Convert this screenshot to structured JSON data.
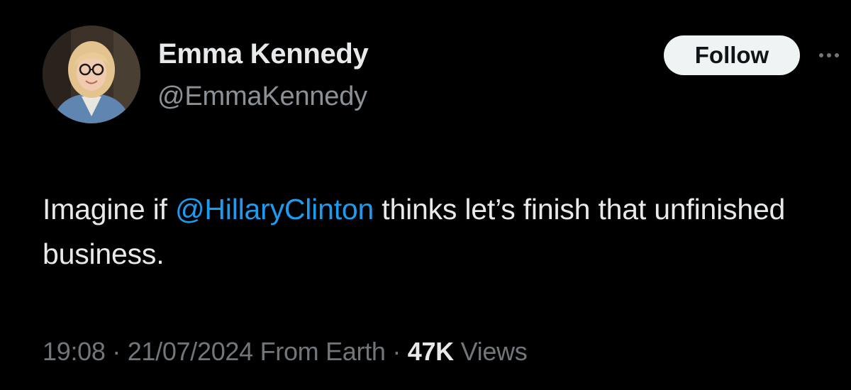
{
  "author": {
    "display_name": "Emma Kennedy",
    "handle": "@EmmaKennedy"
  },
  "follow_label": "Follow",
  "more_icon": "more-horizontal-icon",
  "tweet": {
    "text_before": "Imagine if ",
    "mention": "@HillaryClinton",
    "text_after": " thinks let’s finish that unfinished business."
  },
  "meta": {
    "time": "19:08",
    "separator1": " · ",
    "date": "21/07/2024",
    "source": " From Earth",
    "separator2": " · ",
    "views_count": "47K",
    "views_label": " Views"
  },
  "colors": {
    "background": "#000000",
    "text": "#e7e9ea",
    "secondary": "#71767b",
    "accent": "#1d9bf0",
    "button_bg": "#eff3f4"
  }
}
